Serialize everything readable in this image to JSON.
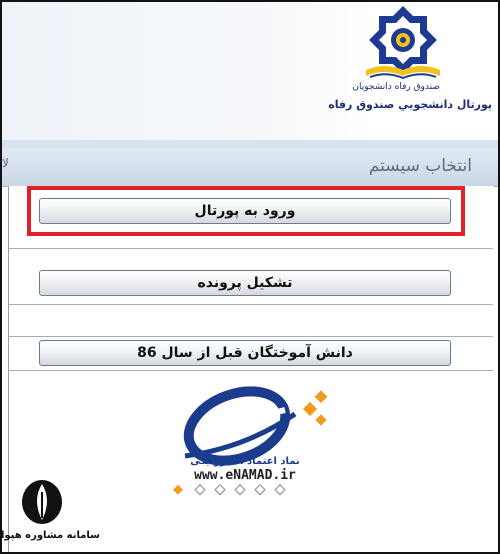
{
  "header": {
    "fund_caption": "صندوق رفاه دانشجویان",
    "portal_title": "پورتال دانشجويي صندوق رفاه"
  },
  "tab": {
    "title": "انتخاب سیستم",
    "left_tag": "لا"
  },
  "buttons": {
    "login": "ورود به پورتال",
    "create_file": "تشکیل پرونده",
    "graduates": "دانش آموختگان قبل از سال 86"
  },
  "enamad": {
    "caption": "نماد اعتماد الکترونیکی",
    "url": "www.eNAMAD.ir"
  },
  "watermark": {
    "text": "سامانه مشاوره هپوا"
  },
  "colors": {
    "highlight": "#e0232a",
    "brand_blue": "#1c2f73"
  }
}
